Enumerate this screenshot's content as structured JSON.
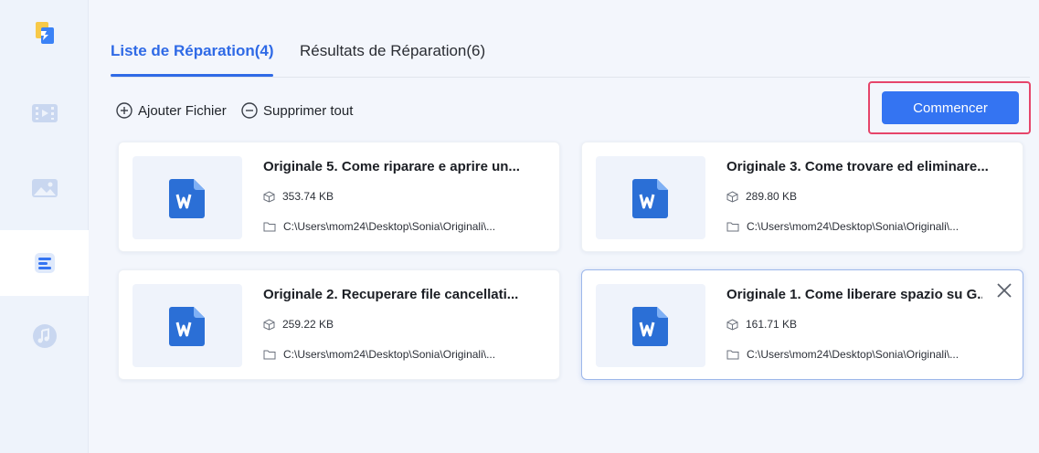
{
  "sidebar": {
    "items": [
      {
        "icon": "app-logo-icon"
      },
      {
        "icon": "video-icon"
      },
      {
        "icon": "image-icon"
      },
      {
        "icon": "document-icon",
        "active": true
      },
      {
        "icon": "audio-icon"
      }
    ]
  },
  "tabs": [
    {
      "label": "Liste de Réparation(4)",
      "active": true
    },
    {
      "label": "Résultats de Réparation(6)",
      "active": false
    }
  ],
  "toolbar": {
    "add_label": "Ajouter Fichier",
    "remove_all_label": "Supprimer tout",
    "start_label": "Commencer"
  },
  "files": [
    {
      "name": "Originale 5. Come riparare e aprire un...",
      "size": "353.74 KB",
      "path": "C:\\Users\\mom24\\Desktop\\Sonia\\Originali\\..."
    },
    {
      "name": "Originale 3. Come trovare ed eliminare...",
      "size": "289.80 KB",
      "path": "C:\\Users\\mom24\\Desktop\\Sonia\\Originali\\..."
    },
    {
      "name": "Originale 2. Recuperare file cancellati...",
      "size": "259.22 KB",
      "path": "C:\\Users\\mom24\\Desktop\\Sonia\\Originali\\..."
    },
    {
      "name": "Originale 1. Come liberare spazio su G...",
      "size": "161.71 KB",
      "path": "C:\\Users\\mom24\\Desktop\\Sonia\\Originali\\...",
      "selected": true
    }
  ],
  "colors": {
    "accent": "#2f6ae6",
    "button": "#3474f2",
    "highlight_border": "#e6456a",
    "word_icon": "#2b6fd6"
  }
}
